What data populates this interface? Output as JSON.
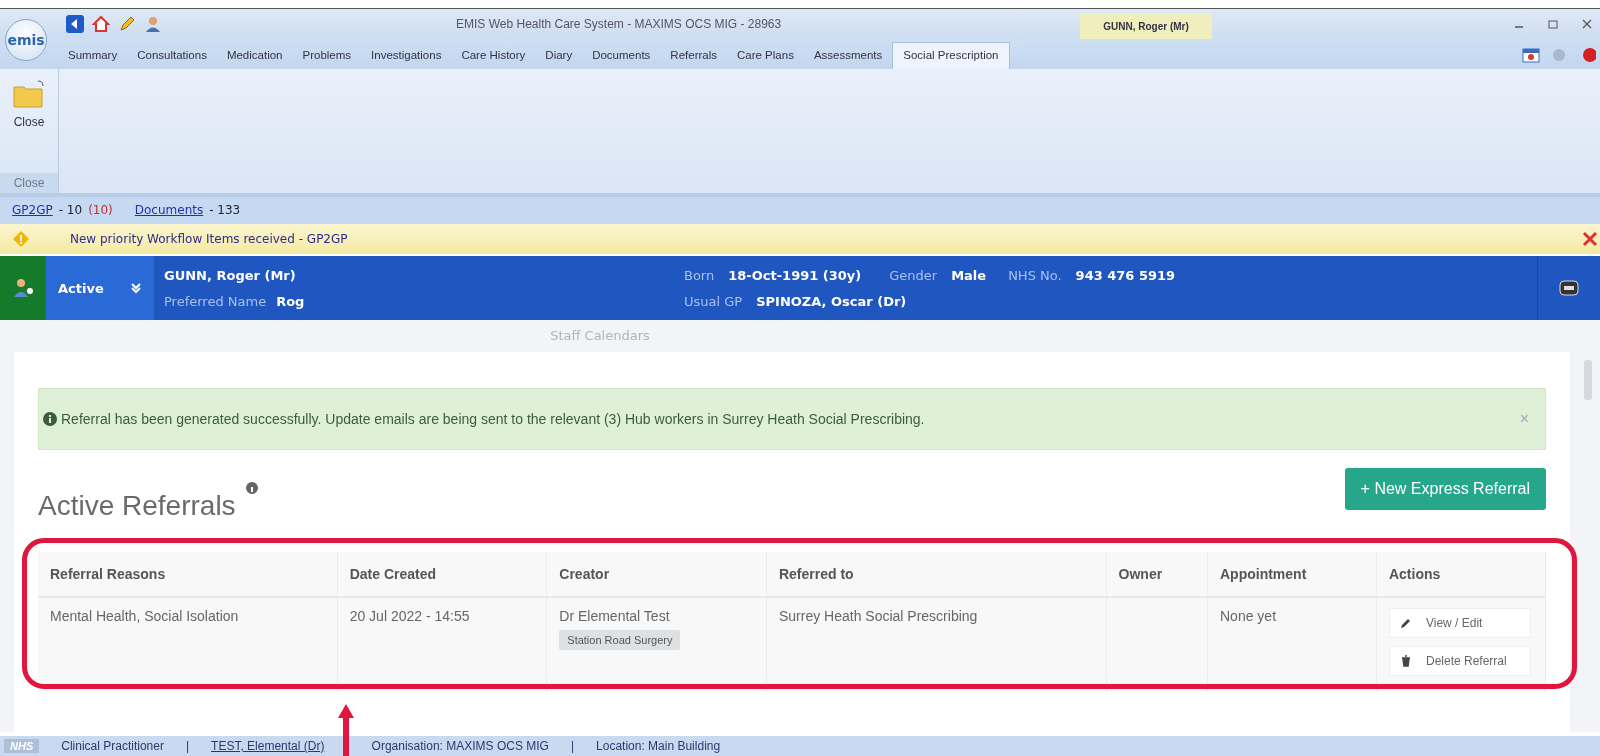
{
  "window": {
    "title": "EMIS Web Health Care System - MAXIMS OCS MIG - 28963",
    "patient_tab": "GUNN, Roger (Mr)",
    "logo": "emis"
  },
  "tabs": [
    {
      "label": "Summary",
      "selected": false
    },
    {
      "label": "Consultations",
      "selected": false
    },
    {
      "label": "Medication",
      "selected": false
    },
    {
      "label": "Problems",
      "selected": false
    },
    {
      "label": "Investigations",
      "selected": false
    },
    {
      "label": "Care History",
      "selected": false
    },
    {
      "label": "Diary",
      "selected": false
    },
    {
      "label": "Documents",
      "selected": false
    },
    {
      "label": "Referrals",
      "selected": false
    },
    {
      "label": "Care Plans",
      "selected": false
    },
    {
      "label": "Assessments",
      "selected": false
    },
    {
      "label": "Social Prescription",
      "selected": true
    }
  ],
  "ribbon": {
    "button": "Close",
    "group": "Close"
  },
  "links": [
    {
      "label": "GP2GP",
      "count": "- 10",
      "alert": "(10)"
    },
    {
      "label": "Documents",
      "count": "- 133"
    }
  ],
  "warning": {
    "text": "New priority Workflow Items received - GP2GP"
  },
  "patient": {
    "status": "Active",
    "name": "GUNN, Roger (Mr)",
    "preferred_label": "Preferred Name",
    "preferred": "Rog",
    "born_label": "Born",
    "born": "18-Oct-1991 (30y)",
    "gender_label": "Gender",
    "gender": "Male",
    "nhs_label": "NHS No.",
    "nhs": "943 476 5919",
    "gp_label": "Usual GP",
    "gp": "SPINOZA, Oscar (Dr)"
  },
  "page_title": "Staff Calendars",
  "alert": {
    "text": "Referral has been generated successfully. Update emails are being sent to the relevant (3) Hub workers in Surrey Heath Social Prescribing.",
    "close": "×"
  },
  "section": {
    "title": "Active Referrals",
    "button": "+ New Express Referral"
  },
  "table": {
    "columns": [
      "Referral Reasons",
      "Date Created",
      "Creator",
      "Referred to",
      "Owner",
      "Appointment",
      "Actions"
    ],
    "rows": [
      {
        "reasons": "Mental Health, Social Isolation",
        "date": "20 Jul 2022 - 14:55",
        "creator": "Dr Elemental Test",
        "practice": "Station Road Surgery",
        "referred_to": "Surrey Heath Social Prescribing",
        "appointment": "None yet",
        "actions": [
          {
            "label": "View / Edit",
            "kind": "edit"
          },
          {
            "label": "Delete Referral",
            "kind": "delete"
          }
        ]
      }
    ]
  },
  "status_bar": {
    "logo": "NHS",
    "separator": "|",
    "items": [
      {
        "text": "Clinical Practitioner",
        "kind": "text"
      },
      {
        "text": "TEST, Elemental (Dr)",
        "kind": "link"
      },
      {
        "text": "Organisation: MAXIMS OCS MIG",
        "kind": "text"
      },
      {
        "text": "Location: Main Building",
        "kind": "text"
      }
    ]
  }
}
